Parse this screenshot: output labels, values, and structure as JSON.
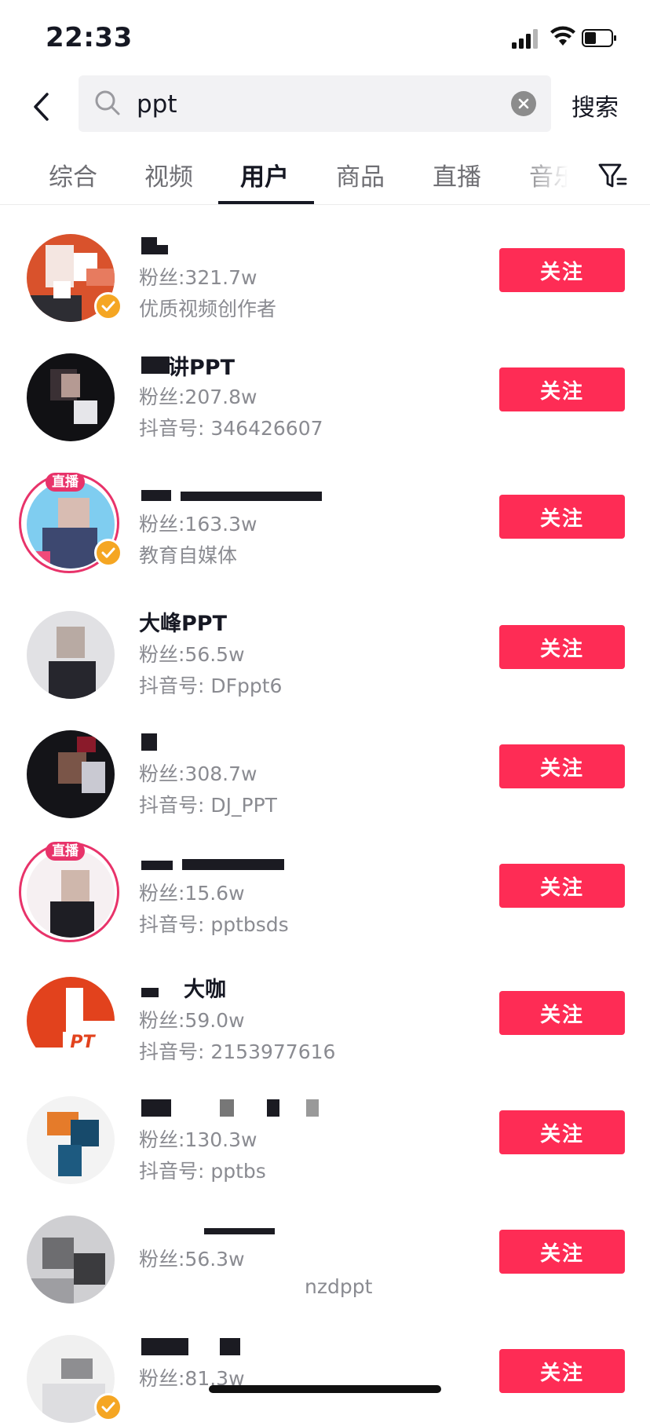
{
  "status_bar": {
    "time": "22:33"
  },
  "search": {
    "query": "ppt",
    "button_label": "搜索"
  },
  "tabs": [
    "综合",
    "视频",
    "用户",
    "商品",
    "直播",
    "音乐"
  ],
  "active_tab": "用户",
  "colors": {
    "accent": "#fe2c55",
    "verified": "#f5a623",
    "live": "#e8336a"
  },
  "users": [
    {
      "nickname_visible": "",
      "fans": "粉丝:321.7w",
      "subinfo": "优质视频创作者",
      "verified": true,
      "live": false,
      "follow_label": "关注"
    },
    {
      "nickname_visible": "讲PPT",
      "fans": "粉丝:207.8w",
      "subinfo": "抖音号: 346426607",
      "verified": false,
      "live": false,
      "follow_label": "关注"
    },
    {
      "nickname_visible": "",
      "fans": "粉丝:163.3w",
      "subinfo": "教育自媒体",
      "verified": true,
      "live": true,
      "live_label": "直播",
      "follow_label": "关注"
    },
    {
      "nickname_visible": "大峰PPT",
      "fans": "粉丝:56.5w",
      "subinfo": "抖音号: DFppt6",
      "verified": false,
      "live": false,
      "follow_label": "关注"
    },
    {
      "nickname_visible": "",
      "fans": "粉丝:308.7w",
      "subinfo": "抖音号: DJ_PPT",
      "verified": false,
      "live": false,
      "follow_label": "关注"
    },
    {
      "nickname_visible": "",
      "fans": "粉丝:15.6w",
      "subinfo": "抖音号: pptbsds",
      "verified": false,
      "live": true,
      "live_label": "直播",
      "follow_label": "关注"
    },
    {
      "nickname_visible": "大咖",
      "fans": "粉丝:59.0w",
      "subinfo": "抖音号: 2153977616",
      "verified": false,
      "live": false,
      "follow_label": "关注"
    },
    {
      "nickname_visible": "",
      "fans": "粉丝:130.3w",
      "subinfo": "抖音号: pptbs",
      "verified": false,
      "live": false,
      "follow_label": "关注"
    },
    {
      "nickname_visible": "",
      "fans": "粉丝:56.3w",
      "subinfo": "nzdppt",
      "verified": false,
      "live": false,
      "follow_label": "关注"
    },
    {
      "nickname_visible": "",
      "fans": "粉丝:81.3w",
      "subinfo": "",
      "verified": true,
      "live": false,
      "follow_label": "关注"
    }
  ]
}
